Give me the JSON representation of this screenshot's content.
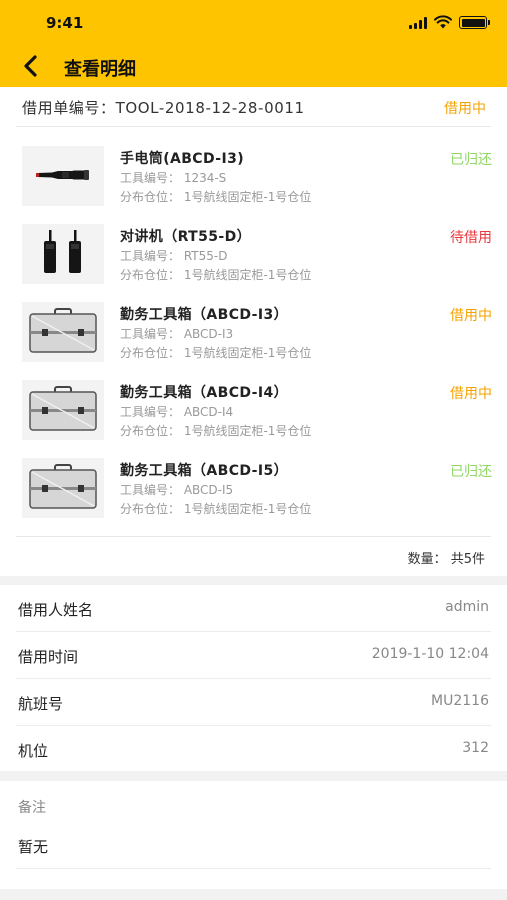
{
  "status_bar": {
    "time": "9:41"
  },
  "header": {
    "title": "查看明细",
    "back_icon": "chevron-left-icon"
  },
  "order": {
    "label": "借用单编号：TOOL-2018-12-28-0011",
    "status": "借用中",
    "status_color": "#f5a300"
  },
  "items": [
    {
      "name": "手电筒(ABCD-I3)",
      "code": "工具编号：  1234-S",
      "location": "分布仓位：  1号航线固定柜-1号仓位",
      "status": "已归还",
      "image": "flashlight"
    },
    {
      "name": "对讲机（RT55-D）",
      "code": "工具编号：  RT55-D",
      "location": "分布仓位：  1号航线固定柜-1号仓位",
      "status": "待借用",
      "image": "walkie-talkie"
    },
    {
      "name": "勤务工具箱（ABCD-I3）",
      "code": "工具编号：  ABCD-I3",
      "location": "分布仓位：  1号航线固定柜-1号仓位",
      "status": "借用中",
      "image": "toolbox"
    },
    {
      "name": "勤务工具箱（ABCD-I4）",
      "code": "工具编号：  ABCD-I4",
      "location": "分布仓位：  1号航线固定柜-1号仓位",
      "status": "借用中",
      "image": "toolbox"
    },
    {
      "name": "勤务工具箱（ABCD-I5）",
      "code": "工具编号：  ABCD-I5",
      "location": "分布仓位：  1号航线固定柜-1号仓位",
      "status": "已归还",
      "image": "toolbox"
    }
  ],
  "quantity": "数量：  共5件",
  "info": [
    {
      "label": "借用人姓名",
      "value": "admin"
    },
    {
      "label": "借用时间",
      "value": "2019-1-10 12:04"
    },
    {
      "label": "航班号",
      "value": "MU2116"
    },
    {
      "label": "机位",
      "value": "312"
    }
  ],
  "remark": {
    "label": "备注",
    "value": "暂无"
  },
  "colors": {
    "header": "#ffc400",
    "status_returned": "#8fd663",
    "status_pending": "#e8383d",
    "status_borrowed": "#f5a300"
  }
}
